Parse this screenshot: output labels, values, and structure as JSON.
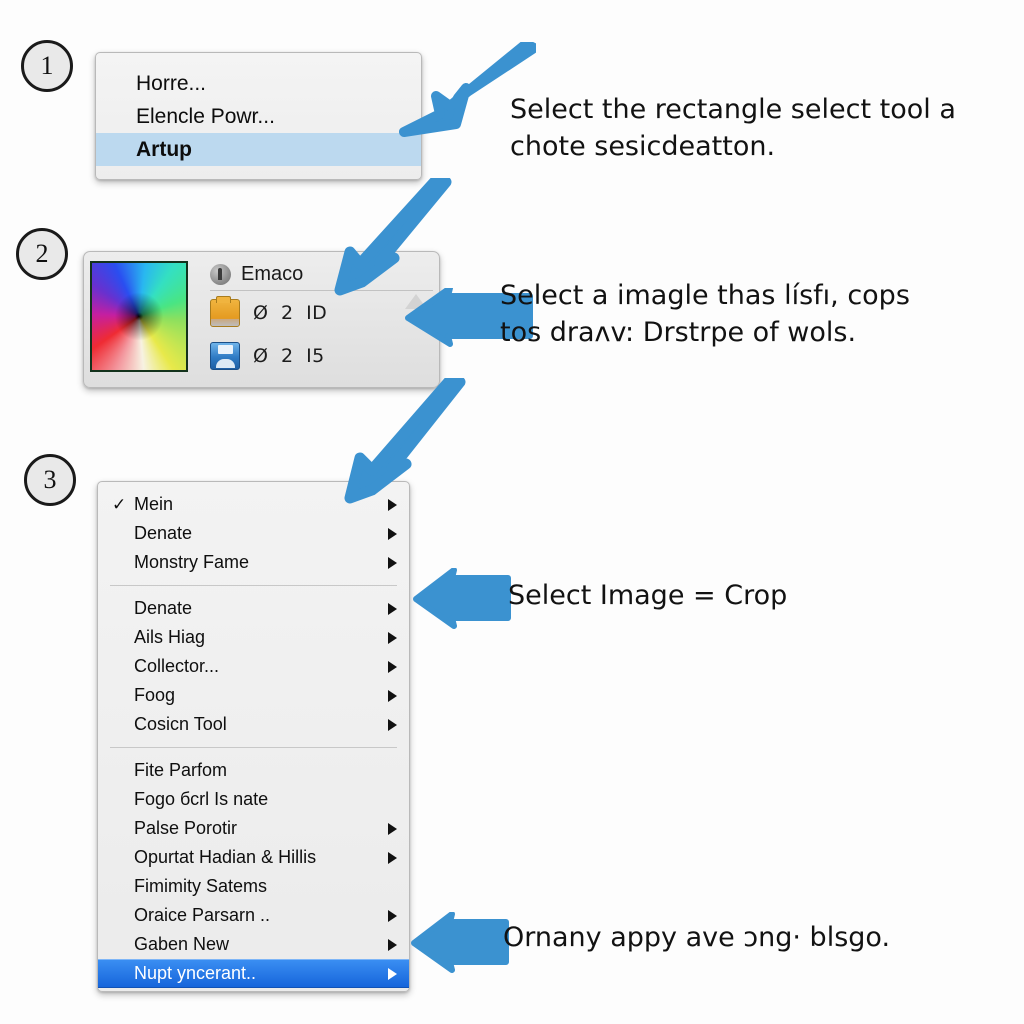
{
  "background_color": "#fdfdfd",
  "accent_color": "#3b92d0",
  "steps": [
    {
      "number": "1"
    },
    {
      "number": "2"
    },
    {
      "number": "3"
    }
  ],
  "menu_one": {
    "items": [
      {
        "label": "Horre...",
        "selected": false
      },
      {
        "label": "Elencle Powr...",
        "selected": false
      },
      {
        "label": "Artup",
        "selected": true
      }
    ],
    "highlight_color": "#bcd9ef"
  },
  "panel_two": {
    "title": "Emaco",
    "title_icon": "gnome-foot-icon",
    "swatch_icon": "color-wheel-icon",
    "rows": [
      {
        "icon": "folder-icon",
        "glyph": "Ø",
        "number": "2",
        "unit": "ID"
      },
      {
        "icon": "floppy-save-icon",
        "glyph": "Ø",
        "number": "2",
        "unit": "I5"
      }
    ]
  },
  "menu_three": {
    "selection_color": "#1665db",
    "groups": [
      {
        "items": [
          {
            "label": "Mein",
            "checked": true,
            "submenu": true
          },
          {
            "label": "Denate",
            "checked": false,
            "submenu": true
          },
          {
            "label": "Monstry Fame",
            "checked": false,
            "submenu": true
          }
        ]
      },
      {
        "items": [
          {
            "label": "Denate",
            "checked": false,
            "submenu": true
          },
          {
            "label": "Ails Hiag",
            "checked": false,
            "submenu": true
          },
          {
            "label": "Collector...",
            "checked": false,
            "submenu": true
          },
          {
            "label": "Foog",
            "checked": false,
            "submenu": true
          },
          {
            "label": "Cosicn Tool",
            "checked": false,
            "submenu": true
          }
        ]
      },
      {
        "items": [
          {
            "label": "Fite Parfom",
            "checked": false,
            "submenu": false
          },
          {
            "label": "Fogo бсrl Is nate",
            "checked": false,
            "submenu": false
          },
          {
            "label": "Palse Porotir",
            "checked": false,
            "submenu": true
          },
          {
            "label": "Opurtat Hadian & Hillis",
            "checked": false,
            "submenu": true
          },
          {
            "label": "Fimimity Satems",
            "checked": false,
            "submenu": false
          },
          {
            "label": "Oraice Parsarn ..",
            "checked": false,
            "submenu": true
          },
          {
            "label": "Gaben New",
            "checked": false,
            "submenu": true
          },
          {
            "label": "Nupt yncerant..",
            "checked": false,
            "submenu": true,
            "selected": true
          }
        ]
      }
    ]
  },
  "annotations": [
    {
      "text": "Select the rectangle select tool a\nchote sesicdeatton."
    },
    {
      "text": "Select a imagle thas lı́sfı, cops\ntos draʌv: Drstrpe of wols."
    },
    {
      "text": "Select Image = Crop"
    },
    {
      "text": "Ornany appy ave ɔng· blsgo."
    }
  ],
  "arrows": [
    {
      "name": "arrow-to-menu-one",
      "direction": "down-left"
    },
    {
      "name": "arrow-menu-one-to-panel-two",
      "direction": "down-left"
    },
    {
      "name": "arrow-to-panel-two",
      "direction": "left"
    },
    {
      "name": "arrow-panel-two-to-menu-three",
      "direction": "down-left"
    },
    {
      "name": "arrow-to-menu-three-middle",
      "direction": "left"
    },
    {
      "name": "arrow-to-menu-three-bottom",
      "direction": "left"
    }
  ]
}
